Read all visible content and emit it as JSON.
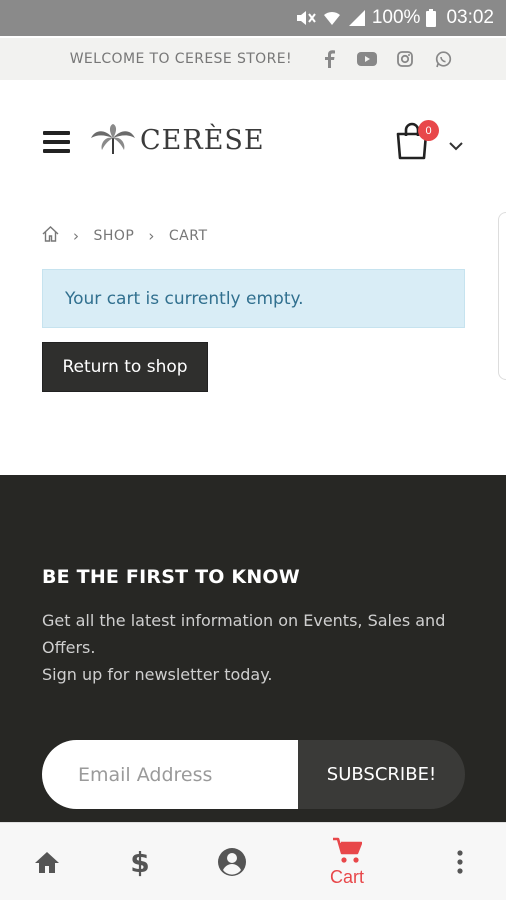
{
  "status_bar": {
    "battery": "100%",
    "time": "03:02"
  },
  "topbar": {
    "welcome": "WELCOME TO CERESE STORE!"
  },
  "header": {
    "logo_text": "CERÈSE",
    "cart_count": "0"
  },
  "breadcrumb": {
    "shop": "SHOP",
    "cart": "CART"
  },
  "cart": {
    "empty_message": "Your cart is currently empty.",
    "return_button": "Return to shop"
  },
  "newsletter": {
    "title": "BE THE FIRST TO KNOW",
    "line1": "Get all the latest information on Events, Sales and Offers.",
    "line2": "Sign up for newsletter today.",
    "email_placeholder": "Email Address",
    "subscribe_label": "SUBSCRIBE!"
  },
  "bottom_nav": {
    "cart_label": "Cart"
  },
  "colors": {
    "accent": "#e8474a",
    "footer_bg": "#272724",
    "notice_bg": "#d9edf6"
  }
}
